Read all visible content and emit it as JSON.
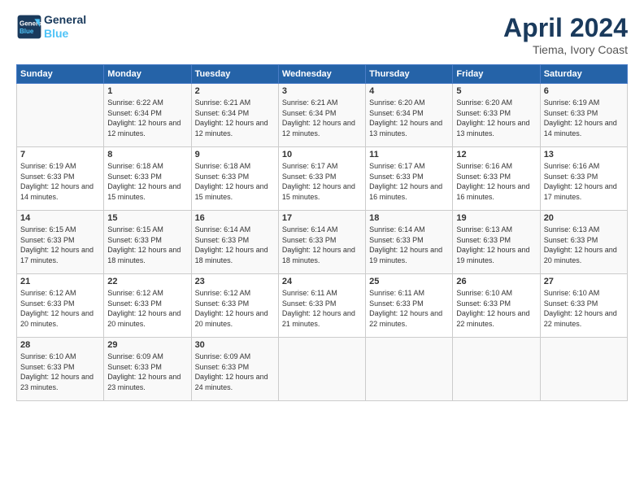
{
  "header": {
    "logo_line1": "General",
    "logo_line2": "Blue",
    "month_title": "April 2024",
    "location": "Tiema, Ivory Coast"
  },
  "weekdays": [
    "Sunday",
    "Monday",
    "Tuesday",
    "Wednesday",
    "Thursday",
    "Friday",
    "Saturday"
  ],
  "weeks": [
    [
      {
        "day": "",
        "sunrise": "",
        "sunset": "",
        "daylight": ""
      },
      {
        "day": "1",
        "sunrise": "Sunrise: 6:22 AM",
        "sunset": "Sunset: 6:34 PM",
        "daylight": "Daylight: 12 hours and 12 minutes."
      },
      {
        "day": "2",
        "sunrise": "Sunrise: 6:21 AM",
        "sunset": "Sunset: 6:34 PM",
        "daylight": "Daylight: 12 hours and 12 minutes."
      },
      {
        "day": "3",
        "sunrise": "Sunrise: 6:21 AM",
        "sunset": "Sunset: 6:34 PM",
        "daylight": "Daylight: 12 hours and 12 minutes."
      },
      {
        "day": "4",
        "sunrise": "Sunrise: 6:20 AM",
        "sunset": "Sunset: 6:34 PM",
        "daylight": "Daylight: 12 hours and 13 minutes."
      },
      {
        "day": "5",
        "sunrise": "Sunrise: 6:20 AM",
        "sunset": "Sunset: 6:33 PM",
        "daylight": "Daylight: 12 hours and 13 minutes."
      },
      {
        "day": "6",
        "sunrise": "Sunrise: 6:19 AM",
        "sunset": "Sunset: 6:33 PM",
        "daylight": "Daylight: 12 hours and 14 minutes."
      }
    ],
    [
      {
        "day": "7",
        "sunrise": "Sunrise: 6:19 AM",
        "sunset": "Sunset: 6:33 PM",
        "daylight": "Daylight: 12 hours and 14 minutes."
      },
      {
        "day": "8",
        "sunrise": "Sunrise: 6:18 AM",
        "sunset": "Sunset: 6:33 PM",
        "daylight": "Daylight: 12 hours and 15 minutes."
      },
      {
        "day": "9",
        "sunrise": "Sunrise: 6:18 AM",
        "sunset": "Sunset: 6:33 PM",
        "daylight": "Daylight: 12 hours and 15 minutes."
      },
      {
        "day": "10",
        "sunrise": "Sunrise: 6:17 AM",
        "sunset": "Sunset: 6:33 PM",
        "daylight": "Daylight: 12 hours and 15 minutes."
      },
      {
        "day": "11",
        "sunrise": "Sunrise: 6:17 AM",
        "sunset": "Sunset: 6:33 PM",
        "daylight": "Daylight: 12 hours and 16 minutes."
      },
      {
        "day": "12",
        "sunrise": "Sunrise: 6:16 AM",
        "sunset": "Sunset: 6:33 PM",
        "daylight": "Daylight: 12 hours and 16 minutes."
      },
      {
        "day": "13",
        "sunrise": "Sunrise: 6:16 AM",
        "sunset": "Sunset: 6:33 PM",
        "daylight": "Daylight: 12 hours and 17 minutes."
      }
    ],
    [
      {
        "day": "14",
        "sunrise": "Sunrise: 6:15 AM",
        "sunset": "Sunset: 6:33 PM",
        "daylight": "Daylight: 12 hours and 17 minutes."
      },
      {
        "day": "15",
        "sunrise": "Sunrise: 6:15 AM",
        "sunset": "Sunset: 6:33 PM",
        "daylight": "Daylight: 12 hours and 18 minutes."
      },
      {
        "day": "16",
        "sunrise": "Sunrise: 6:14 AM",
        "sunset": "Sunset: 6:33 PM",
        "daylight": "Daylight: 12 hours and 18 minutes."
      },
      {
        "day": "17",
        "sunrise": "Sunrise: 6:14 AM",
        "sunset": "Sunset: 6:33 PM",
        "daylight": "Daylight: 12 hours and 18 minutes."
      },
      {
        "day": "18",
        "sunrise": "Sunrise: 6:14 AM",
        "sunset": "Sunset: 6:33 PM",
        "daylight": "Daylight: 12 hours and 19 minutes."
      },
      {
        "day": "19",
        "sunrise": "Sunrise: 6:13 AM",
        "sunset": "Sunset: 6:33 PM",
        "daylight": "Daylight: 12 hours and 19 minutes."
      },
      {
        "day": "20",
        "sunrise": "Sunrise: 6:13 AM",
        "sunset": "Sunset: 6:33 PM",
        "daylight": "Daylight: 12 hours and 20 minutes."
      }
    ],
    [
      {
        "day": "21",
        "sunrise": "Sunrise: 6:12 AM",
        "sunset": "Sunset: 6:33 PM",
        "daylight": "Daylight: 12 hours and 20 minutes."
      },
      {
        "day": "22",
        "sunrise": "Sunrise: 6:12 AM",
        "sunset": "Sunset: 6:33 PM",
        "daylight": "Daylight: 12 hours and 20 minutes."
      },
      {
        "day": "23",
        "sunrise": "Sunrise: 6:12 AM",
        "sunset": "Sunset: 6:33 PM",
        "daylight": "Daylight: 12 hours and 20 minutes."
      },
      {
        "day": "24",
        "sunrise": "Sunrise: 6:11 AM",
        "sunset": "Sunset: 6:33 PM",
        "daylight": "Daylight: 12 hours and 21 minutes."
      },
      {
        "day": "25",
        "sunrise": "Sunrise: 6:11 AM",
        "sunset": "Sunset: 6:33 PM",
        "daylight": "Daylight: 12 hours and 22 minutes."
      },
      {
        "day": "26",
        "sunrise": "Sunrise: 6:10 AM",
        "sunset": "Sunset: 6:33 PM",
        "daylight": "Daylight: 12 hours and 22 minutes."
      },
      {
        "day": "27",
        "sunrise": "Sunrise: 6:10 AM",
        "sunset": "Sunset: 6:33 PM",
        "daylight": "Daylight: 12 hours and 22 minutes."
      }
    ],
    [
      {
        "day": "28",
        "sunrise": "Sunrise: 6:10 AM",
        "sunset": "Sunset: 6:33 PM",
        "daylight": "Daylight: 12 hours and 23 minutes."
      },
      {
        "day": "29",
        "sunrise": "Sunrise: 6:09 AM",
        "sunset": "Sunset: 6:33 PM",
        "daylight": "Daylight: 12 hours and 23 minutes."
      },
      {
        "day": "30",
        "sunrise": "Sunrise: 6:09 AM",
        "sunset": "Sunset: 6:33 PM",
        "daylight": "Daylight: 12 hours and 24 minutes."
      },
      {
        "day": "",
        "sunrise": "",
        "sunset": "",
        "daylight": ""
      },
      {
        "day": "",
        "sunrise": "",
        "sunset": "",
        "daylight": ""
      },
      {
        "day": "",
        "sunrise": "",
        "sunset": "",
        "daylight": ""
      },
      {
        "day": "",
        "sunrise": "",
        "sunset": "",
        "daylight": ""
      }
    ]
  ]
}
